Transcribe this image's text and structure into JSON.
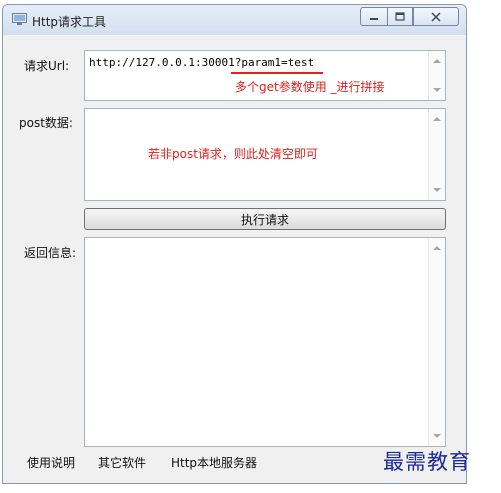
{
  "window": {
    "title": "Http请求工具",
    "minimize_icon": "minimize-icon",
    "maximize_icon": "maximize-icon",
    "close_icon": "close-icon"
  },
  "request_url": {
    "label": "请求Url:",
    "value": "http://127.0.0.1:30001?param1=test",
    "annotation": "多个get参数使用 _进行拼接"
  },
  "post_data": {
    "label": "post数据:",
    "value": "",
    "annotation": "若非post请求，则此处清空即可"
  },
  "execute_button": {
    "label": "执行请求"
  },
  "response": {
    "label": "返回信息:",
    "value": ""
  },
  "footer": {
    "links": [
      "使用说明",
      "其它软件",
      "Http本地服务器"
    ]
  },
  "watermark": "最需教育",
  "colors": {
    "annotation": "#e0201b",
    "watermark": "#1b2a9e"
  }
}
